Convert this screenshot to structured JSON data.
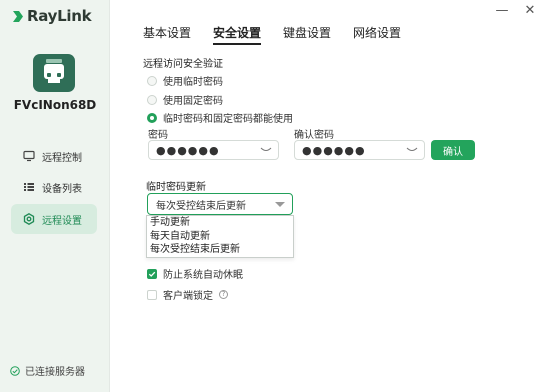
{
  "app": {
    "logo_text": "RayLink",
    "device_name": "FVcINon68D"
  },
  "sidebar": {
    "items": [
      {
        "label": "远程控制",
        "icon": "monitor-icon",
        "active": false
      },
      {
        "label": "设备列表",
        "icon": "list-icon",
        "active": false
      },
      {
        "label": "远程设置",
        "icon": "settings-icon",
        "active": true
      }
    ],
    "server_status": "已连接服务器"
  },
  "window": {
    "minimize": "—",
    "close": "✕"
  },
  "tabs": [
    {
      "label": "基本设置",
      "active": false
    },
    {
      "label": "安全设置",
      "active": true
    },
    {
      "label": "键盘设置",
      "active": false
    },
    {
      "label": "网络设置",
      "active": false
    }
  ],
  "security": {
    "heading": "远程访问安全验证",
    "options": [
      {
        "label": "使用临时密码",
        "checked": false
      },
      {
        "label": "使用固定密码",
        "checked": false
      },
      {
        "label": "临时密码和固定密码都能使用",
        "checked": true
      }
    ],
    "password_label": "密码",
    "password_value": "●●●●●●",
    "confirm_label": "确认密码",
    "confirm_value": "●●●●●●",
    "confirm_button": "确认"
  },
  "temp_password": {
    "heading": "临时密码更新",
    "selected": "每次受控结束后更新",
    "options": [
      "手动更新",
      "每天自动更新",
      "每次受控结束后更新"
    ]
  },
  "checks": [
    {
      "label": "防止系统自动休眠",
      "checked": true
    },
    {
      "label": "客户端锁定",
      "checked": false,
      "help": "?"
    }
  ],
  "colors": {
    "accent": "#22a05a",
    "sidebar_bg": "#eef4ef",
    "active_item_bg": "#d7ecdf"
  }
}
